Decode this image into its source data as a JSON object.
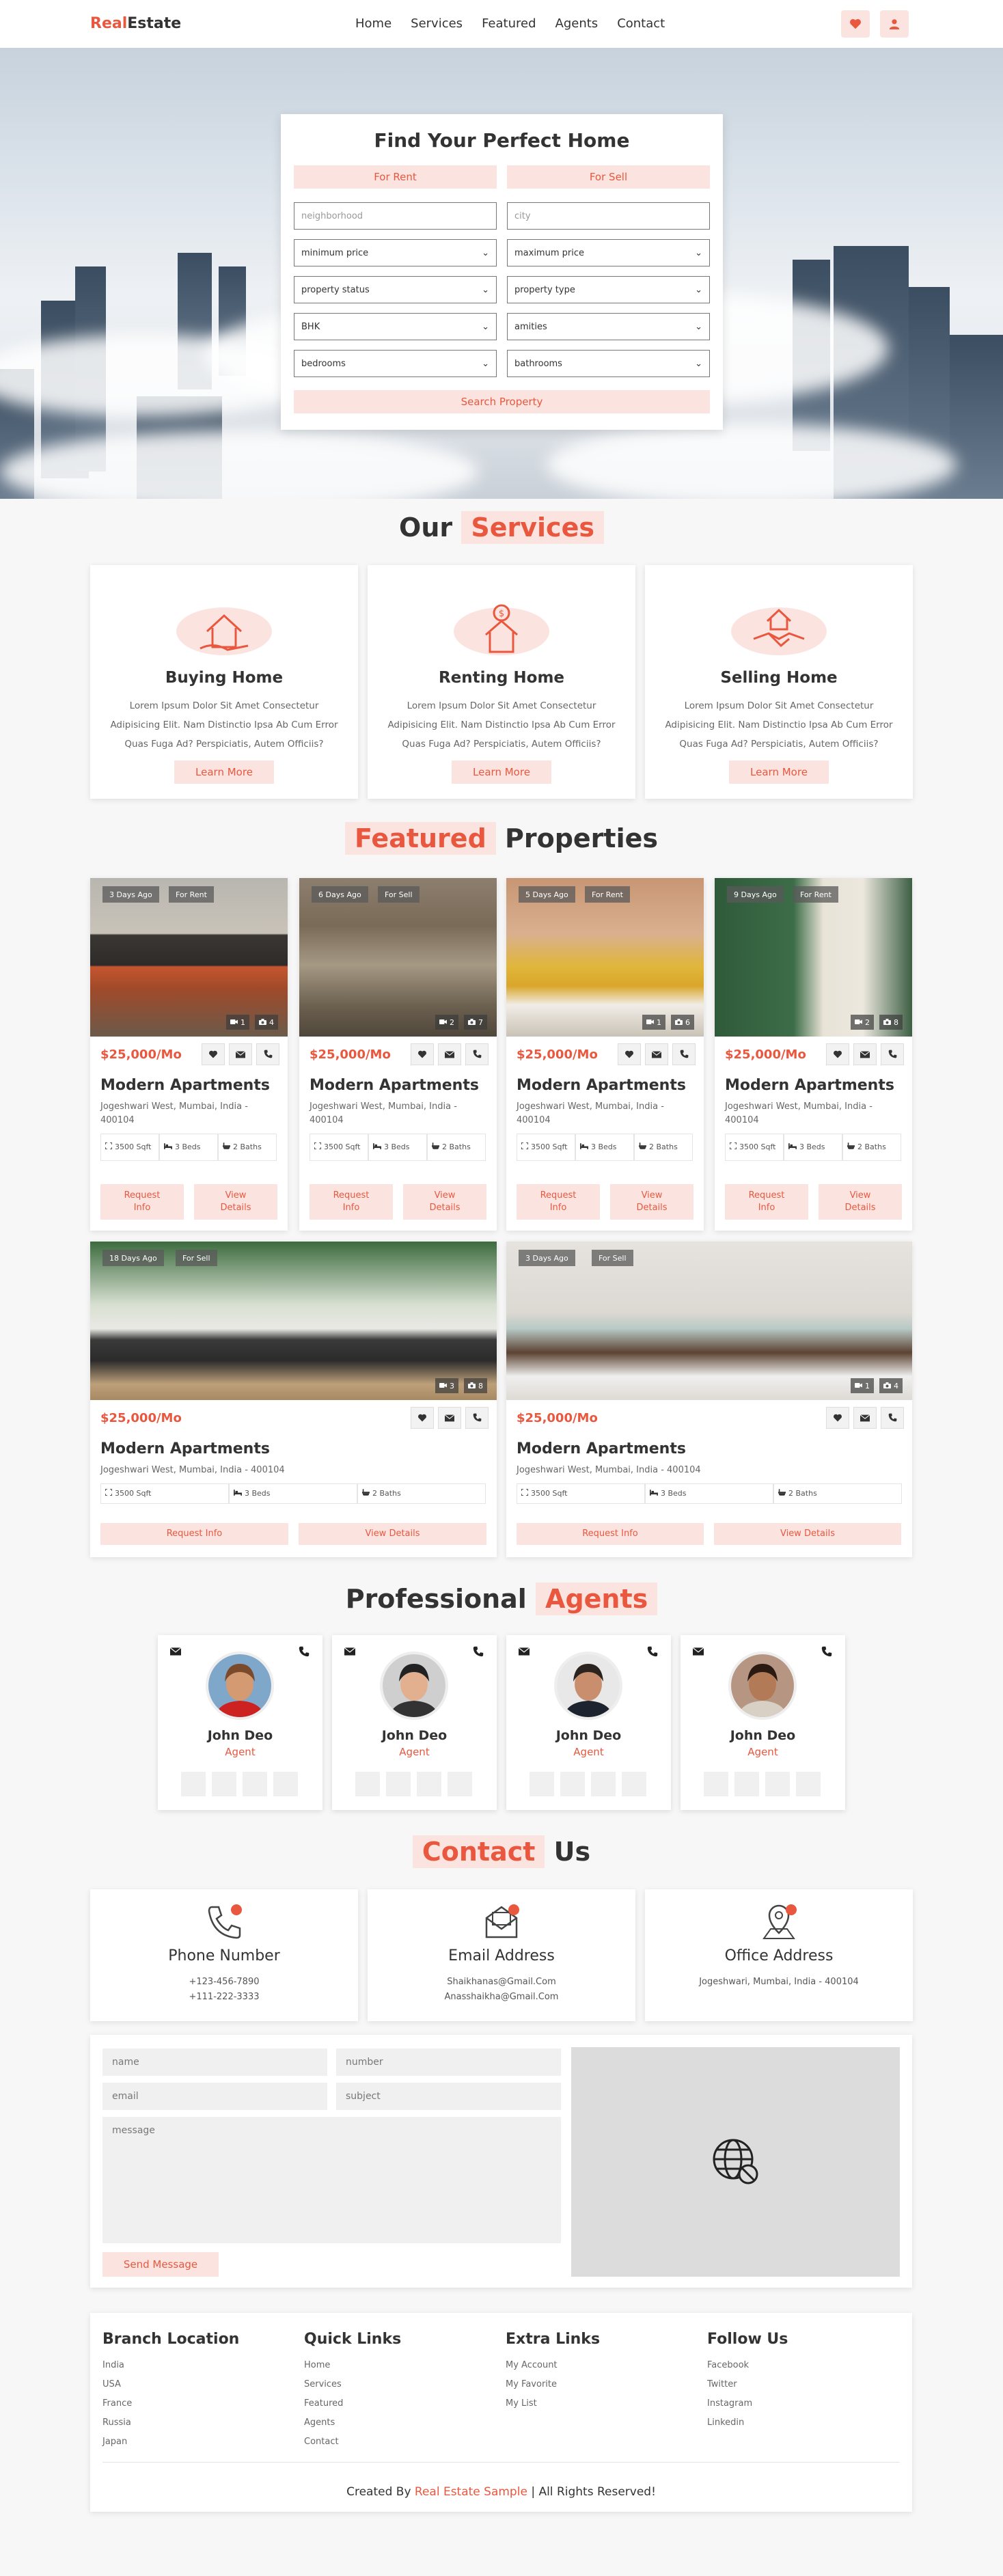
{
  "header": {
    "logo_a": "Real",
    "logo_b": "Estate",
    "nav": [
      "Home",
      "Services",
      "Featured",
      "Agents",
      "Contact"
    ]
  },
  "search": {
    "title": "Find Your Perfect Home",
    "tab_rent": "For Rent",
    "tab_sell": "For Sell",
    "neighborhood_ph": "neighborhood",
    "city_ph": "city",
    "min_price": "minimum price",
    "max_price": "maximum price",
    "property_status": "property status",
    "property_type": "property type",
    "bhk": "BHK",
    "amenities": "amities",
    "bedrooms": "bedrooms",
    "bathrooms": "bathrooms",
    "button": "Search Property"
  },
  "services": {
    "head_a": "Our",
    "head_b": "Services",
    "items": [
      {
        "title": "Buying Home",
        "desc": "Lorem Ipsum Dolor Sit Amet Consectetur Adipisicing Elit. Nam Distinctio Ipsa Ab Cum Error Quas Fuga Ad? Perspiciatis, Autem Officiis?",
        "button": "Learn More"
      },
      {
        "title": "Renting Home",
        "desc": "Lorem Ipsum Dolor Sit Amet Consectetur Adipisicing Elit. Nam Distinctio Ipsa Ab Cum Error Quas Fuga Ad? Perspiciatis, Autem Officiis?",
        "button": "Learn More"
      },
      {
        "title": "Selling Home",
        "desc": "Lorem Ipsum Dolor Sit Amet Consectetur Adipisicing Elit. Nam Distinctio Ipsa Ab Cum Error Quas Fuga Ad? Perspiciatis, Autem Officiis?",
        "button": "Learn More"
      }
    ]
  },
  "featured": {
    "head_a": "Featured",
    "head_b": "Properties",
    "cards": [
      {
        "age": "3 Days Ago",
        "status": "For Rent",
        "videos": "1",
        "photos": "4",
        "price": "$25,000/Mo",
        "title": "Modern Apartments",
        "address": "Jogeshwari West, Mumbai, India - 400104",
        "area": "3500 Sqft",
        "beds": "3 Beds",
        "baths": "2 Baths",
        "req": "Request Info",
        "view": "View Details"
      },
      {
        "age": "6 Days Ago",
        "status": "For Sell",
        "videos": "2",
        "photos": "7",
        "price": "$25,000/Mo",
        "title": "Modern Apartments",
        "address": "Jogeshwari West, Mumbai, India - 400104",
        "area": "3500 Sqft",
        "beds": "3 Beds",
        "baths": "2 Baths",
        "req": "Request Info",
        "view": "View Details"
      },
      {
        "age": "5 Days Ago",
        "status": "For Rent",
        "videos": "1",
        "photos": "6",
        "price": "$25,000/Mo",
        "title": "Modern Apartments",
        "address": "Jogeshwari West, Mumbai, India - 400104",
        "area": "3500 Sqft",
        "beds": "3 Beds",
        "baths": "2 Baths",
        "req": "Request Info",
        "view": "View Details"
      },
      {
        "age": "9 Days Ago",
        "status": "For Rent",
        "videos": "2",
        "photos": "8",
        "price": "$25,000/Mo",
        "title": "Modern Apartments",
        "address": "Jogeshwari West, Mumbai, India - 400104",
        "area": "3500 Sqft",
        "beds": "3 Beds",
        "baths": "2 Baths",
        "req": "Request Info",
        "view": "View Details"
      },
      {
        "age": "18 Days Ago",
        "status": "For Sell",
        "videos": "3",
        "photos": "8",
        "price": "$25,000/Mo",
        "title": "Modern Apartments",
        "address": "Jogeshwari West, Mumbai, India - 400104",
        "area": "3500 Sqft",
        "beds": "3 Beds",
        "baths": "2 Baths",
        "req": "Request Info",
        "view": "View Details"
      },
      {
        "age": "3 Days Ago",
        "status": "For Sell",
        "videos": "1",
        "photos": "4",
        "price": "$25,000/Mo",
        "title": "Modern Apartments",
        "address": "Jogeshwari West, Mumbai, India - 400104",
        "area": "3500 Sqft",
        "beds": "3 Beds",
        "baths": "2 Baths",
        "req": "Request Info",
        "view": "View Details"
      }
    ]
  },
  "agents": {
    "head_a": "Professional",
    "head_b": "Agents",
    "items": [
      {
        "name": "John Deo",
        "role": "Agent"
      },
      {
        "name": "John Deo",
        "role": "Agent"
      },
      {
        "name": "John Deo",
        "role": "Agent"
      },
      {
        "name": "John Deo",
        "role": "Agent"
      }
    ]
  },
  "contact": {
    "head_a": "Contact",
    "head_b": "Us",
    "boxes": [
      {
        "title": "Phone Number",
        "line1": "+123-456-7890",
        "line2": "+111-222-3333"
      },
      {
        "title": "Email Address",
        "line1": "Shaikhanas@Gmail.Com",
        "line2": "Anasshaikha@Gmail.Com"
      },
      {
        "title": "Office Address",
        "line1": "Jogeshwari, Mumbai, India - 400104",
        "line2": ""
      }
    ],
    "form": {
      "name": "name",
      "number": "number",
      "email": "email",
      "subject": "subject",
      "message": "message",
      "send": "Send Message"
    }
  },
  "footer": {
    "cols": [
      {
        "title": "Branch Location",
        "links": [
          "India",
          "USA",
          "France",
          "Russia",
          "Japan"
        ]
      },
      {
        "title": "Quick Links",
        "links": [
          "Home",
          "Services",
          "Featured",
          "Agents",
          "Contact"
        ]
      },
      {
        "title": "Extra Links",
        "links": [
          "My Account",
          "My Favorite",
          "My List"
        ]
      },
      {
        "title": "Follow Us",
        "links": [
          "Facebook",
          "Twitter",
          "Instagram",
          "Linkedin"
        ]
      }
    ],
    "credit_a": "Created By",
    "credit_b": "Real Estate Sample",
    "credit_c": "| All Rights Reserved!"
  },
  "colors": {
    "accent": "#e9573f",
    "accent_light": "#fbe4e0"
  }
}
